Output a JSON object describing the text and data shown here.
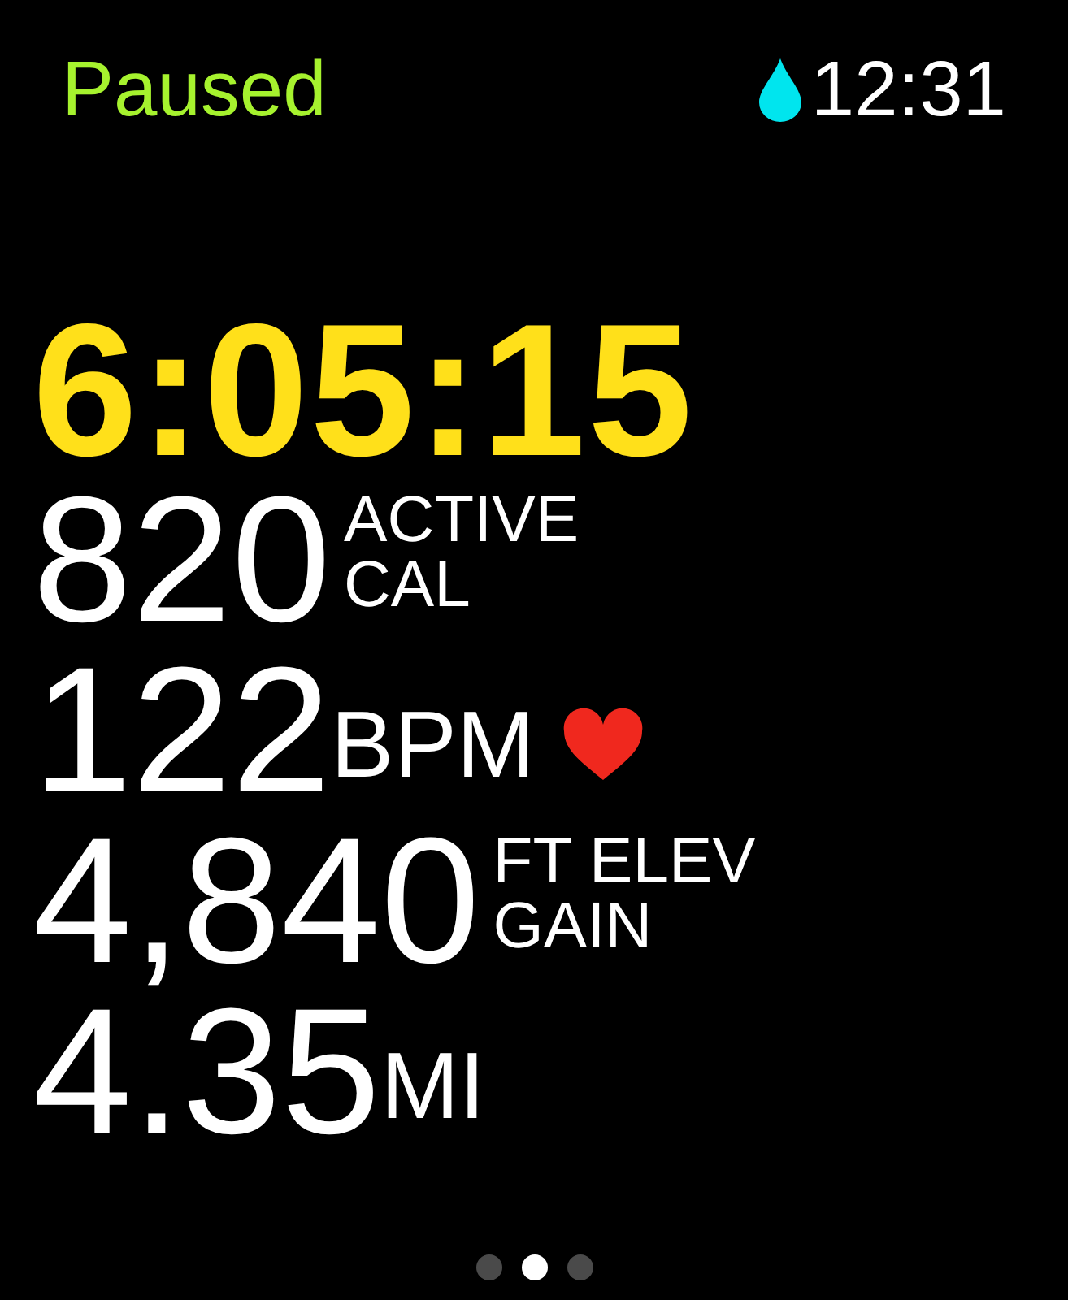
{
  "status_bar": {
    "state": "Paused",
    "clock": "12:31",
    "water_lock": true
  },
  "timer": "6:05:15",
  "metrics": [
    {
      "kind": "stacked",
      "value": "820",
      "unit": "ACTIVE\nCAL"
    },
    {
      "kind": "inline",
      "value": "122",
      "unit": "BPM",
      "heart": true
    },
    {
      "kind": "stacked",
      "value": "4,840",
      "unit": "FT ELEV\nGAIN"
    },
    {
      "kind": "inline",
      "value": "4.35",
      "unit": "MI"
    }
  ],
  "page_dots": [
    {
      "selected": false
    },
    {
      "selected": true
    },
    {
      "selected": false
    }
  ]
}
